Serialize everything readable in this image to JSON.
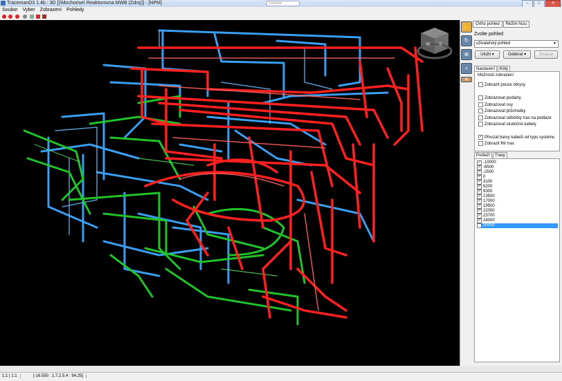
{
  "window": {
    "title": "TracemanD3 1.4b : 3D [(\\Mochorise\\ Reaktorovna.MWB (Zdroj)] - [NPM]",
    "search_placeholder": "Vyhledat"
  },
  "menu": [
    "Soubor",
    "Vyber",
    "Zobrazení",
    "Pohledy"
  ],
  "toolbar_icons": [
    "red-circle-icon",
    "blue-circle-icon",
    "gear-icon",
    "grid-icon",
    "flag-icon",
    "x-icon"
  ],
  "view_tabs": {
    "active": "Ortho pohled",
    "other": "Režim řezu"
  },
  "view": {
    "label": "Zvolte pohled",
    "select_value": "uživatelský pohled",
    "btn_add": "Uložit",
    "btn_remove": "Odebrat",
    "btn_delete": "Smazat"
  },
  "options_tabs": {
    "active": "Nastavení",
    "other": "Kóty"
  },
  "options": {
    "section_title": "Možnosti zobrazení",
    "items": [
      {
        "label": "Zobrazit pouze obrysy",
        "checked": false
      },
      {
        "label": "Zobrazovat podlahy",
        "checked": false
      },
      {
        "label": "Zobrazovat osy",
        "checked": false
      },
      {
        "label": "Zobrazovat průchodky",
        "checked": false
      },
      {
        "label": "Zobrazovat odbočky tras na podlaze",
        "checked": false
      },
      {
        "label": "Zobrazovat skutečné kabely",
        "checked": false
      },
      {
        "label": "Převzat barvy kabelů od typu systému",
        "checked": true
      },
      {
        "label": "Zobrazit filtr tras",
        "checked": false
      }
    ]
  },
  "levels_tabs": {
    "active": "Podlaží",
    "other": "Trasy"
  },
  "levels": [
    "-10000",
    "-8500",
    "-2500",
    "0",
    "3100",
    "6200",
    "9300",
    "13500",
    "17000",
    "19500",
    "22050",
    "23700",
    "24000",
    "30000"
  ],
  "levels_selected": "30000",
  "status": {
    "left": "1:1 | 1:1",
    "coords": "[-16.550 : 1.7.2.5.4 : 94.25]"
  },
  "colors": {
    "red": "#ff2020",
    "blue": "#3a9ff0",
    "green": "#22c22a",
    "accent": "#3399ff"
  }
}
